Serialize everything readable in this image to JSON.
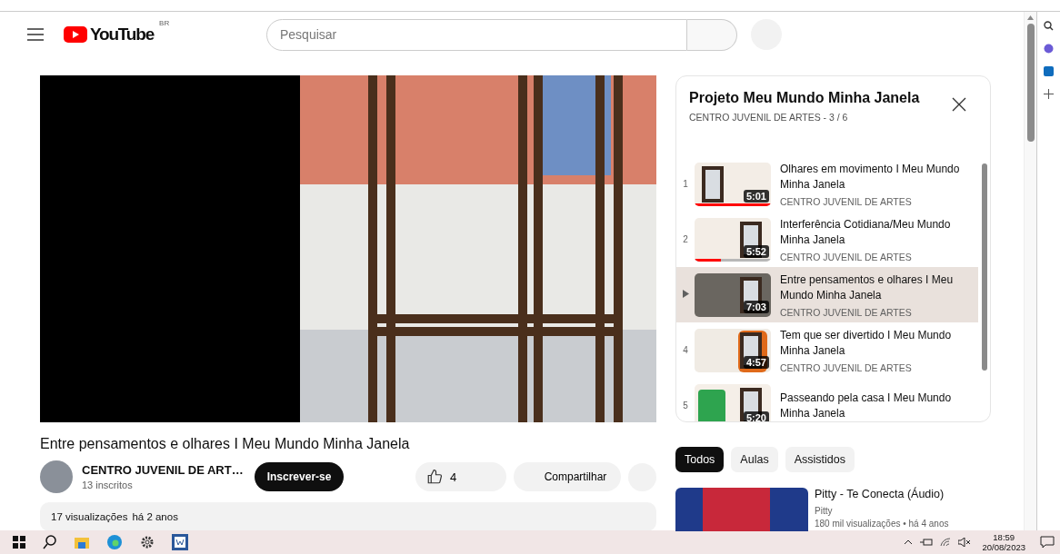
{
  "header": {
    "logo": "YouTube",
    "region": "BR",
    "search": {
      "placeholder": "Pesquisar"
    }
  },
  "video": {
    "title": "Entre pensamentos e olhares I Meu Mundo Minha Janela",
    "channel": {
      "name": "CENTRO JUVENIL DE ART…",
      "subscribers": "13 inscritos"
    },
    "subscribe": "Inscrever-se",
    "likes": "4",
    "share": "Compartilhar",
    "description": {
      "views": "17 visualizações",
      "age": "há 2 anos"
    }
  },
  "playlist": {
    "title": "Projeto Meu Mundo Minha Janela",
    "subtitle": "CENTRO JUVENIL DE ARTES - 3 / 6",
    "items": [
      {
        "index": "1",
        "title": "Olhares em movimento I Meu Mundo Minha Janela",
        "channel": "CENTRO JUVENIL DE ARTES",
        "duration": "5:01",
        "level": 1,
        "selected": false
      },
      {
        "index": "2",
        "title": "Interferência Cotidiana/Meu Mundo Minha Janela",
        "channel": "CENTRO JUVENIL DE ARTES",
        "duration": "5:52",
        "level": 0.35,
        "selected": false
      },
      {
        "title": "Entre pensamentos e olhares I Meu Mundo Minha Janela",
        "channel": "CENTRO JUVENIL DE ARTES",
        "duration": "7:03",
        "selected": true
      },
      {
        "index": "4",
        "title": "Tem que ser divertido I Meu Mundo Minha Janela",
        "channel": "CENTRO JUVENIL DE ARTES",
        "duration": "4:57",
        "selected": false
      },
      {
        "index": "5",
        "title": "Passeando pela casa I Meu Mundo Minha Janela",
        "duration": "5:20",
        "selected": false
      }
    ]
  },
  "chips": [
    {
      "label": "Todos",
      "selected": true
    },
    {
      "label": "Aulas",
      "selected": false
    },
    {
      "label": "Assistidos",
      "selected": false
    }
  ],
  "recommended": [
    {
      "title": "Pitty - Te Conecta (Áudio)",
      "channel": "Pitty",
      "meta": "180 mil visualizações • há 4 anos"
    }
  ],
  "taskbar": {
    "time": "18:59",
    "date": "20/08/2023"
  }
}
